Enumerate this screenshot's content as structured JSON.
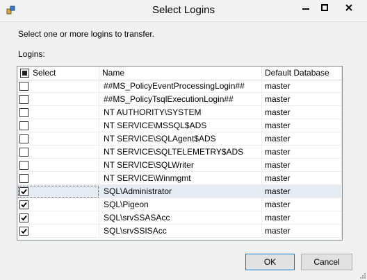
{
  "window": {
    "title": "Select Logins"
  },
  "instructions": "Select one or more logins to transfer.",
  "logins_label": "Logins:",
  "grid": {
    "columns": [
      "Select",
      "Name",
      "Default Database"
    ],
    "rows": [
      {
        "selected": false,
        "name": "##MS_PolicyEventProcessingLogin##",
        "db": "master"
      },
      {
        "selected": false,
        "name": "##MS_PolicyTsqlExecutionLogin##",
        "db": "master"
      },
      {
        "selected": false,
        "name": "NT AUTHORITY\\SYSTEM",
        "db": "master"
      },
      {
        "selected": false,
        "name": "NT SERVICE\\MSSQL$ADS",
        "db": "master"
      },
      {
        "selected": false,
        "name": "NT SERVICE\\SQLAgent$ADS",
        "db": "master"
      },
      {
        "selected": false,
        "name": "NT SERVICE\\SQLTELEMETRY$ADS",
        "db": "master"
      },
      {
        "selected": false,
        "name": "NT SERVICE\\SQLWriter",
        "db": "master"
      },
      {
        "selected": false,
        "name": "NT SERVICE\\Winmgmt",
        "db": "master"
      },
      {
        "selected": true,
        "name": "SQL\\Administrator",
        "db": "master"
      },
      {
        "selected": true,
        "name": "SQL\\Pigeon",
        "db": "master"
      },
      {
        "selected": true,
        "name": "SQL\\srvSSASAcc",
        "db": "master"
      },
      {
        "selected": true,
        "name": "SQL\\srvSSISAcc",
        "db": "master"
      }
    ],
    "highlighted_row": 8
  },
  "buttons": {
    "ok": "OK",
    "cancel": "Cancel"
  }
}
